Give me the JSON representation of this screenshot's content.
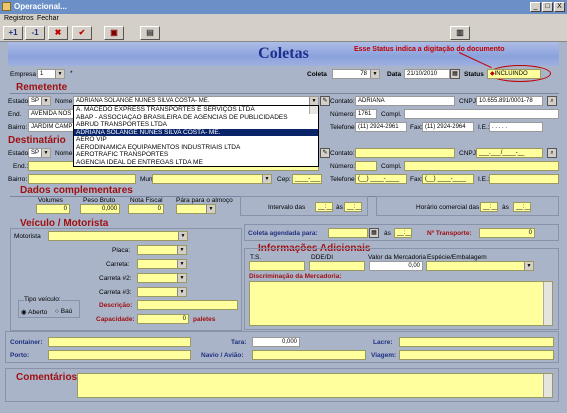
{
  "window": {
    "title": "Operacional...",
    "min": "_",
    "max": "□",
    "close": "X"
  },
  "menu": [
    "Registros",
    "Fechar"
  ],
  "toolbar": {
    "buttons": [
      "+1",
      "-1",
      "✖",
      "✔",
      "▣",
      "▤",
      "▥"
    ]
  },
  "header": {
    "title": "Coletas",
    "note": "Esse Status indica a digitação do documento"
  },
  "top": {
    "empresa_label": "Empresa",
    "empresa_value": "1",
    "empresa_star": "*",
    "coleta_label": "Coleta",
    "coleta_value": "78",
    "data_label": "Data",
    "data_value": "21/10/2010",
    "status_label": "Status",
    "status_value": "INCLUINDO"
  },
  "remetente": {
    "section": "Remetente",
    "estado_label": "Estado:",
    "estado_value": "SP",
    "nome_label": "Nome:",
    "nome_value": "ADRIANA SOLANGE NUNES SILVA COSTA- ME.",
    "end_label": "End.",
    "end_value": "AVENIDA NOS",
    "bairro_label": "Bairro:",
    "bairro_value": "JARDIM CAMP",
    "contato_label": "Contato:",
    "contato_value": "ADRIANA",
    "cnpj_label": "CNPJ:",
    "cnpj_value": "10.655.891/0001-78",
    "numero_label": "Número:",
    "numero_value": "1761",
    "compl_label": "Compl.",
    "telefone_label": "Telefone:",
    "telefone_value": "(11) 2924-2961",
    "fax_label": "Fax:",
    "fax_value": "(11) 2924-2964",
    "ie_label": "I.E.:",
    "ie_value": ". . . . ."
  },
  "dropdown": {
    "items": [
      "A. MACEDO EXPRESS TRANSPORTES E SERVIÇOS LTDA",
      "ABAP - ASSOCIAÇÃO BRASILEIRA DE AGÊNCIAS DE PUBLICIDADES",
      "ABRUD TRANSPORTES LTDA",
      "ADRIANA SOLANGE NUNES SILVA COSTA- ME.",
      "AERO VIP",
      "AERODINAMICA EQUIPAMENTOS INDUSTRIAIS LTDA",
      "AEROTRAFIC TRANSPORTES",
      "AGENCIA IDEAL DE ENTREGAS LTDA ME"
    ],
    "selected_index": 3
  },
  "destinatario": {
    "section": "Destinatário",
    "estado_label": "Estado:",
    "estado_value": "SP",
    "nome_label": "Nome:",
    "end_label": "End.:",
    "bairro_label": "Bairro:",
    "mun_label": "Mun:",
    "cep_label": "Cep:",
    "cep_value": "____-___",
    "contato_label": "Contato:",
    "cnpj_label": "CNPJ:",
    "cnpj_value": "___.___/____-__",
    "numero_label": "Número:",
    "compl_label": "Compl.",
    "telefone_label": "Telefone:",
    "telefone_value": "(__) ____-____",
    "fax_label": "Fax:",
    "fax_value": "(__) ____-____",
    "ie_label": "I.E.:"
  },
  "complementares": {
    "section": "Dados complementares",
    "volumes_label": "Volumes",
    "volumes_value": "0",
    "peso_label": "Peso Bruto",
    "peso_value": "0,000",
    "nf_label": "Nota Fiscal",
    "nf_value": "0",
    "almoco_label": "Pára para o almoço",
    "intervalo_label": "Intervalo das",
    "as1": "às",
    "horario_label": "Horário comercial das",
    "as2": "às",
    "time_blank": "__:__"
  },
  "veiculo": {
    "section": "Veículo / Motorista",
    "motorista_label": "Motorista",
    "placa_label": "Placa:",
    "carreta_label": "Carreta:",
    "carreta2_label": "Carreta #2:",
    "carreta3_label": "Carreta #3:",
    "tipo_label": "Tipo veículo:",
    "aberto_label": "Aberto",
    "bau_label": "Baú",
    "descricao_label": "Descrição:",
    "capacidade_label": "Capacidade:",
    "capacidade_value": "0",
    "paletes_label": "paletes"
  },
  "coleta": {
    "agendada_label": "Coleta agendada para:",
    "as": "às",
    "ntransporte_label": "Nº Transporte:",
    "ntransporte_value": "0"
  },
  "adicionais": {
    "section": "Informações Adicionais",
    "ts_label": "T.S.",
    "dde_label": "DDE/DI",
    "valor_label": "Valor da Mercadoria",
    "valor_value": "0,00",
    "especie_label": "Espécie/Embalagem",
    "discriminacao_label": "Discriminação da Mercadoria:"
  },
  "bottom": {
    "container_label": "Container:",
    "tara_label": "Tara:",
    "tara_value": "0,000",
    "lacre_label": "Lacre:",
    "porto_label": "Porto:",
    "navio_label": "Navio / Avião:",
    "viagem_label": "Viagem:"
  },
  "comentarios": {
    "section": "Comentários"
  }
}
